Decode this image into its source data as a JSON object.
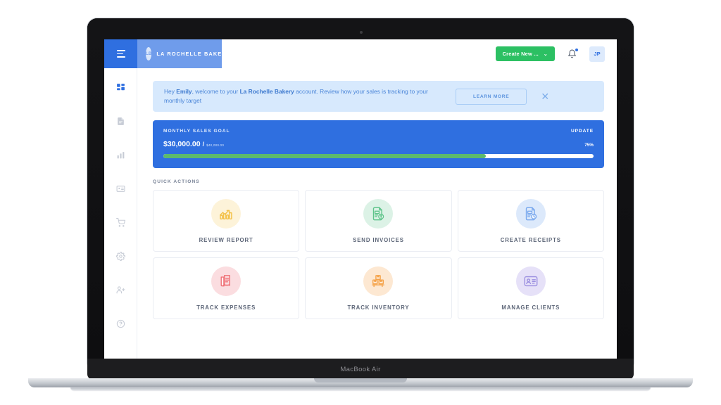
{
  "device": {
    "model_label": "MacBook Air"
  },
  "header": {
    "menu_icon": "hamburger-icon",
    "brand": {
      "avatar_initials": "LB",
      "name": "LA ROCHELLE BAKERY",
      "caret": "⌄"
    },
    "create_button": {
      "label": "Create New ...",
      "caret": "⌄",
      "color": "#2cc063"
    },
    "notifications_icon": "bell-icon",
    "user_avatar": {
      "initials": "JP",
      "color": "#ddeafc"
    }
  },
  "sidebar": {
    "items": [
      {
        "icon": "dashboard-grid-icon",
        "active": true
      },
      {
        "icon": "document-icon",
        "active": false
      },
      {
        "icon": "bar-chart-icon",
        "active": false
      },
      {
        "icon": "id-card-icon",
        "active": false
      },
      {
        "icon": "shopping-cart-icon",
        "active": false
      },
      {
        "icon": "gear-icon",
        "active": false
      },
      {
        "icon": "add-user-icon",
        "active": false
      },
      {
        "icon": "help-circle-icon",
        "active": false
      }
    ],
    "active_color": "#2f6fe0",
    "inactive_color": "#c7ccd6"
  },
  "banner": {
    "greeting_prefix": "Hey ",
    "user_name": "Emily",
    "middle_text": ", welcome to your ",
    "account_name": "La Rochelle Bakery",
    "suffix_text": " account. Review how your sales is tracking to your monthly target",
    "learn_more_label": "LEARN MORE",
    "close_icon": "close-icon",
    "background": "#d7e9fd",
    "text_color": "#4a85d8"
  },
  "goal_card": {
    "title": "MONTHLY SALES GOAL",
    "update_label": "UPDATE",
    "current_amount": "$30,000.00",
    "separator": "/",
    "target_amount": "$40,000.00",
    "percent_label": "75%",
    "progress_percent": 75,
    "background": "#2f6fe0",
    "progress_color": "#5cba6d"
  },
  "quick_actions": {
    "section_title": "QUICK ACTIONS",
    "cards": [
      {
        "label": "REVIEW REPORT",
        "icon": "report-chart-icon",
        "icon_color": "#f3c24b",
        "circle_color": "#fdf3d9"
      },
      {
        "label": "SEND INVOICES",
        "icon": "invoice-icon",
        "icon_color": "#5ec48a",
        "circle_color": "#dcf2e6"
      },
      {
        "label": "CREATE RECEIPTS",
        "icon": "receipt-doc-icon",
        "icon_color": "#7aa9ee",
        "circle_color": "#dce9fb"
      },
      {
        "label": "TRACK EXPENSES",
        "icon": "expense-receipt-icon",
        "icon_color": "#ef6f75",
        "circle_color": "#fbdde0"
      },
      {
        "label": "TRACK INVENTORY",
        "icon": "inventory-boxes-icon",
        "icon_color": "#f5a34a",
        "circle_color": "#fde8d2"
      },
      {
        "label": "MANAGE CLIENTS",
        "icon": "client-card-icon",
        "icon_color": "#9b8fe0",
        "circle_color": "#e6e1f8"
      }
    ]
  }
}
